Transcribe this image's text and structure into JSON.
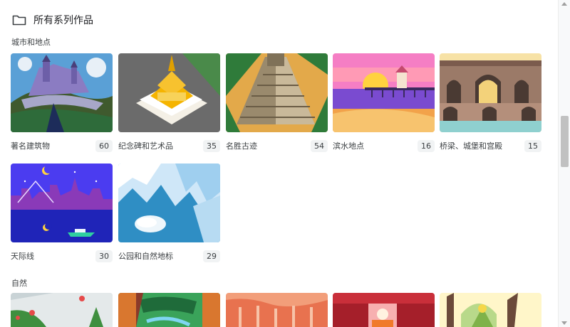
{
  "header": {
    "title": "所有系列作品",
    "icon": "folder-icon"
  },
  "sections": [
    {
      "label": "城市和地点",
      "items": [
        {
          "label": "著名建筑物",
          "count": "60"
        },
        {
          "label": "纪念碑和艺术品",
          "count": "35"
        },
        {
          "label": "名胜古迹",
          "count": "54"
        },
        {
          "label": "滨水地点",
          "count": "16"
        },
        {
          "label": "桥梁、城堡和宫殿",
          "count": "15"
        },
        {
          "label": "天际线",
          "count": "30"
        },
        {
          "label": "公园和自然地标",
          "count": "29"
        }
      ]
    },
    {
      "label": "自然",
      "items": []
    }
  ],
  "colors": {
    "accent_text": "#3c4043",
    "badge_bg": "#f1f3f4"
  }
}
